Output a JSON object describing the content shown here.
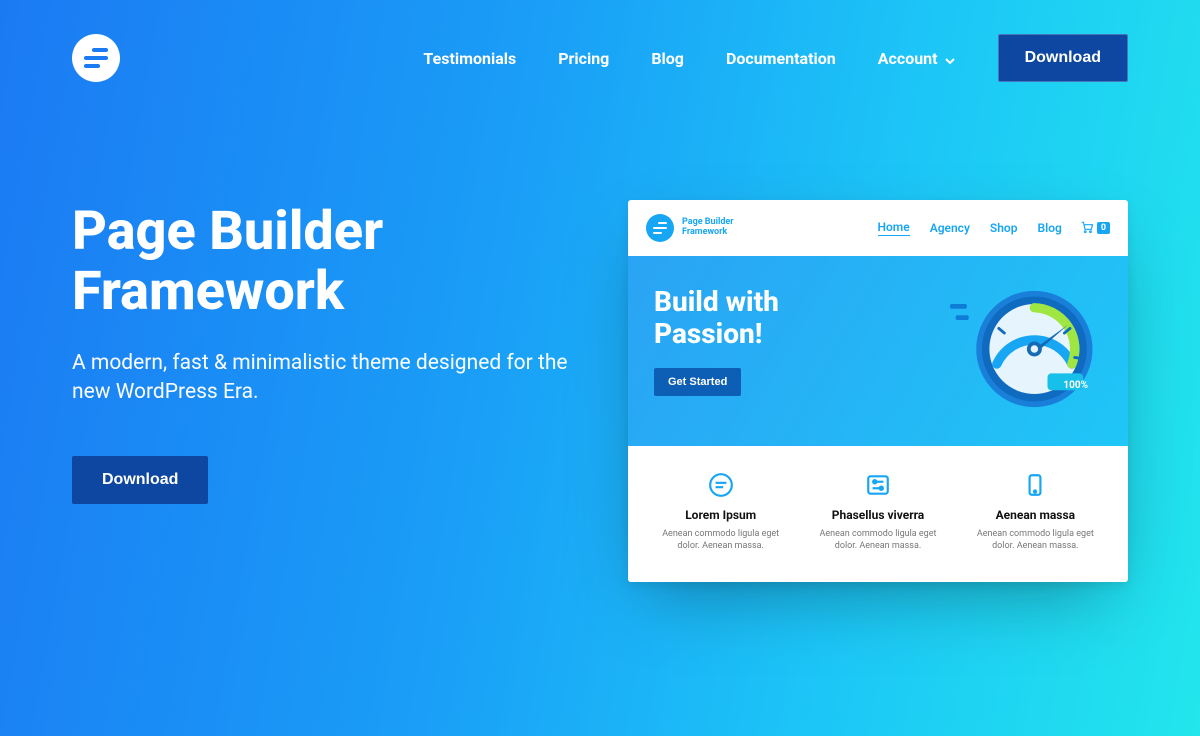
{
  "nav": {
    "items": [
      "Testimonials",
      "Pricing",
      "Blog",
      "Documentation"
    ],
    "account": "Account",
    "download": "Download"
  },
  "hero": {
    "title_line1": "Page Builder",
    "title_line2": "Framework",
    "subtitle": "A modern, fast & minimalistic theme designed for the new WordPress Era.",
    "cta": "Download"
  },
  "preview": {
    "brand_line1": "Page Builder",
    "brand_line2": "Framework",
    "nav": [
      "Home",
      "Agency",
      "Shop",
      "Blog"
    ],
    "cart_count": "0",
    "hero_line1": "Build with",
    "hero_line2": "Passion!",
    "hero_cta": "Get Started",
    "gauge_label": "100%",
    "features": [
      {
        "title": "Lorem Ipsum",
        "desc": "Aenean commodo ligula eget dolor. Aenean massa."
      },
      {
        "title": "Phasellus viverra",
        "desc": "Aenean commodo ligula eget dolor. Aenean massa."
      },
      {
        "title": "Aenean massa",
        "desc": "Aenean commodo ligula eget dolor. Aenean massa."
      }
    ]
  },
  "colors": {
    "accent": "#17a6f4",
    "button_dark": "#0d47a1"
  }
}
